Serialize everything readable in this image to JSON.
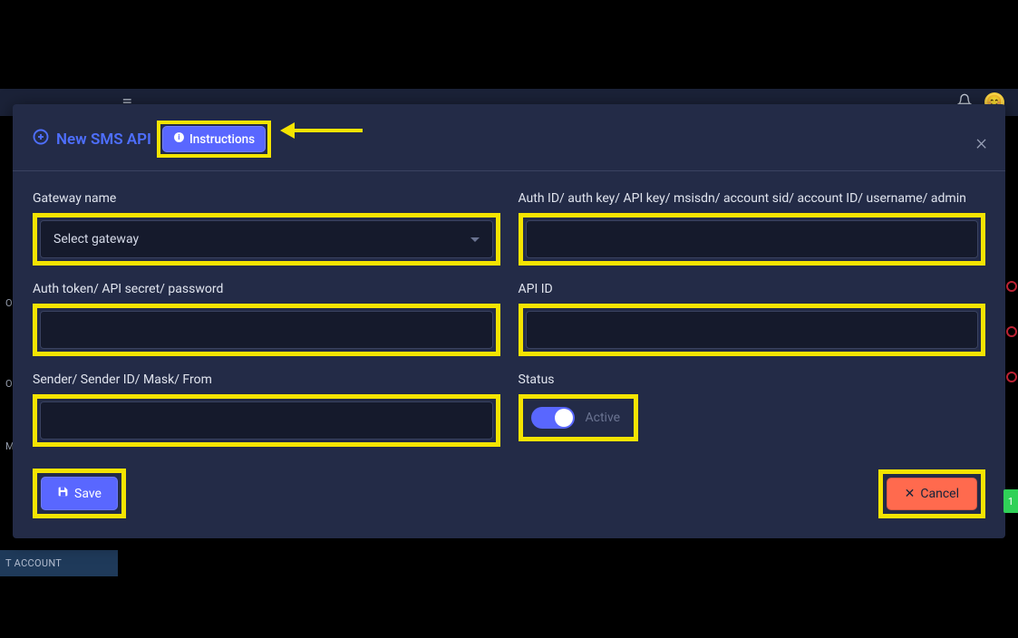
{
  "topbar": {
    "hamburger": "≡",
    "bell": "🔔",
    "avatar_face": "😊"
  },
  "sidebar": {
    "items": [
      "O",
      "O",
      "ME",
      "T ACCOUNT"
    ]
  },
  "modal": {
    "title_icon": "➕",
    "title": "New SMS API",
    "instructions_label": "Instructions",
    "close": "×",
    "fields": {
      "gateway_label": "Gateway name",
      "gateway_placeholder": "Select gateway",
      "auth_id_label": "Auth ID/ auth key/ API key/ msisdn/ account sid/ account ID/ username/ admin",
      "auth_token_label": "Auth token/ API secret/ password",
      "api_id_label": "API ID",
      "sender_label": "Sender/ Sender ID/ Mask/ From",
      "status_label": "Status",
      "status_text": "Active"
    },
    "buttons": {
      "save": "Save",
      "cancel": "Cancel"
    }
  },
  "badge": {
    "count": "1"
  }
}
